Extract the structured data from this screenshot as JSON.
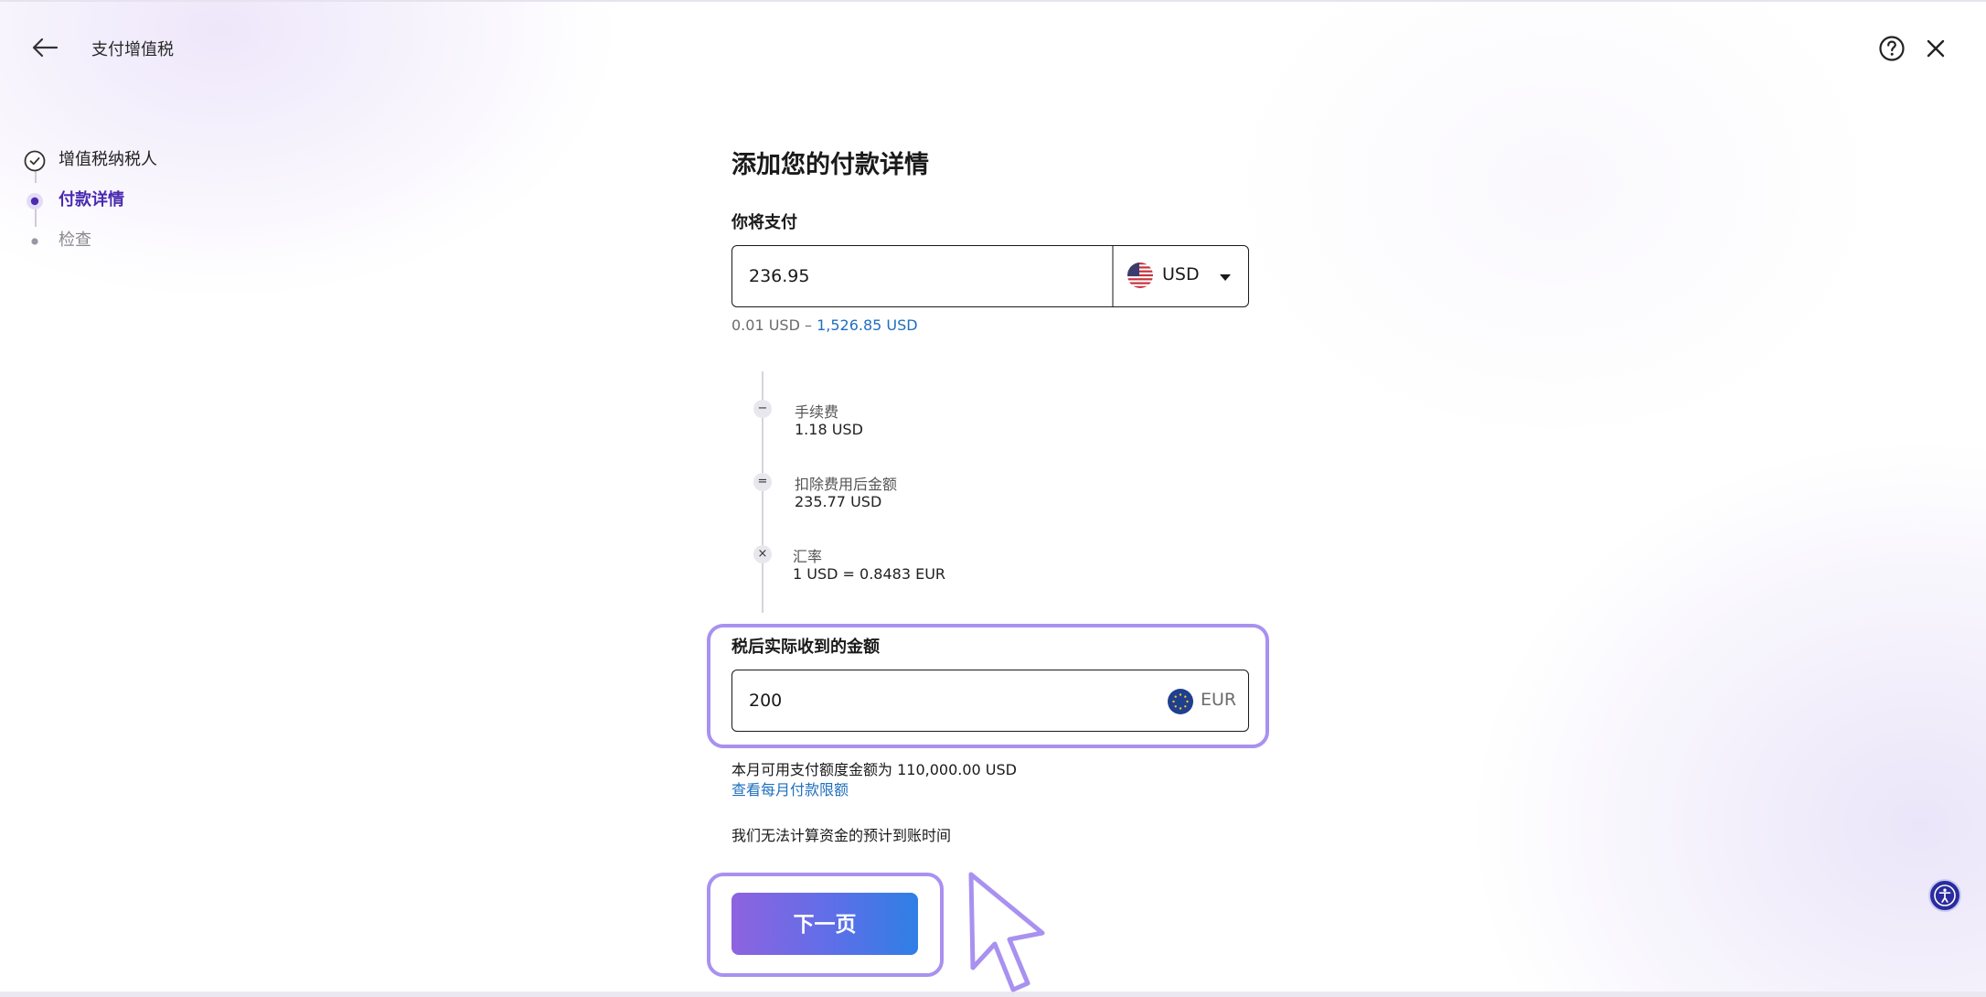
{
  "header": {
    "title": "支付增值税"
  },
  "stepper": {
    "steps": [
      {
        "label": "增值税纳税人",
        "state": "done"
      },
      {
        "label": "付款详情",
        "state": "current"
      },
      {
        "label": "检查",
        "state": "upcoming"
      }
    ]
  },
  "main": {
    "title": "添加您的付款详情",
    "pay": {
      "label": "你将支付",
      "amount": "236.95",
      "currency": "USD",
      "range_min": "0.01 USD – ",
      "range_max": "1,526.85 USD"
    },
    "calc": {
      "fee": {
        "symbol": "−",
        "label": "手续费",
        "value": "1.18 USD"
      },
      "after_fee": {
        "symbol": "=",
        "label": "扣除费用后金额",
        "value": "235.77 USD"
      },
      "rate": {
        "symbol": "×",
        "label": "汇率",
        "value": "1 USD = 0.8483 EUR"
      }
    },
    "receive": {
      "label": "税后实际收到的金额",
      "amount": "200",
      "currency": "EUR"
    },
    "limit_text": "本月可用支付额度金额为 110,000.00 USD",
    "limit_link": "查看每月付款限额",
    "eta_text": "我们无法计算资金的预计到账时间",
    "next_button": "下一页"
  },
  "colors": {
    "accent": "#4a2bb0",
    "highlight": "#a891f0",
    "link": "#1e6fbf"
  }
}
